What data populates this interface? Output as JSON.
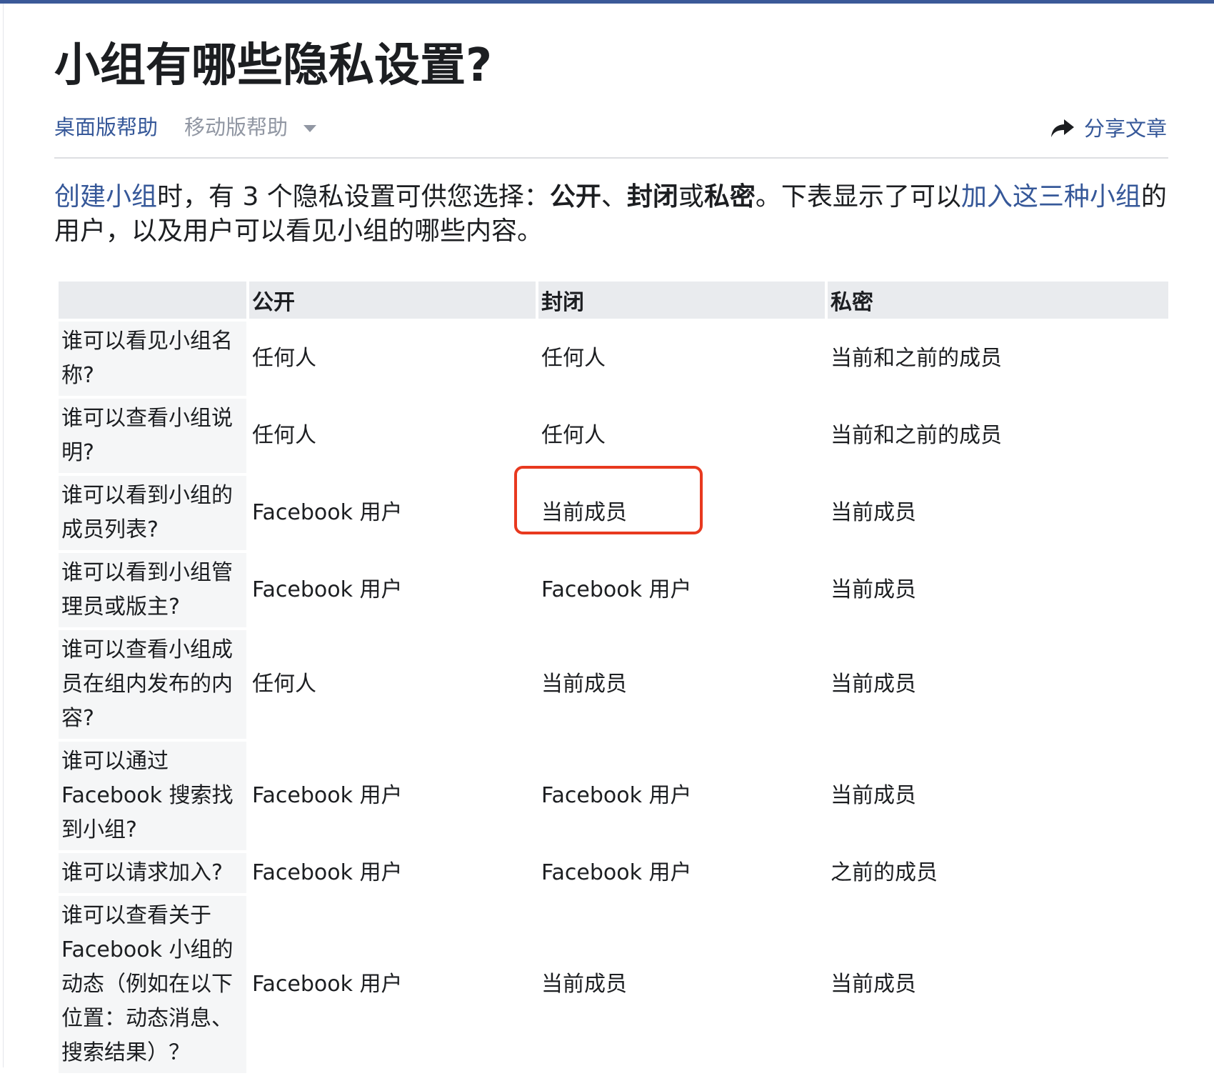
{
  "page": {
    "title": "小组有哪些隐私设置?"
  },
  "tabs": {
    "desktop": "桌面版帮助",
    "mobile": "移动版帮助"
  },
  "share": {
    "label": "分享文章",
    "icon": "share-arrow-icon"
  },
  "intro": {
    "link1": "创建小组",
    "text1": "时，有 3 个隐私设置可供您选择：",
    "opt_public": "公开",
    "sep1": "、",
    "opt_closed": "封闭",
    "sep2": "或",
    "opt_secret": "私密",
    "text2": "。下表显示了可以",
    "link2": "加入这三种小组",
    "text3": "的用户，以及用户可以看见小组的哪些内容。"
  },
  "table": {
    "headers": [
      "",
      "公开",
      "封闭",
      "私密"
    ],
    "rows": [
      [
        "谁可以看见小组名称?",
        "任何人",
        "任何人",
        "当前和之前的成员"
      ],
      [
        "谁可以查看小组说明?",
        "任何人",
        "任何人",
        "当前和之前的成员"
      ],
      [
        "谁可以看到小组的成员列表?",
        "Facebook 用户",
        "当前成员",
        "当前成员"
      ],
      [
        "谁可以看到小组管理员或版主?",
        "Facebook 用户",
        "Facebook 用户",
        "当前成员"
      ],
      [
        "谁可以查看小组成员在组内发布的内容?",
        "任何人",
        "当前成员",
        "当前成员"
      ],
      [
        "谁可以通过 Facebook 搜索找到小组?",
        "Facebook 用户",
        "Facebook 用户",
        "当前成员"
      ],
      [
        "谁可以请求加入?",
        "Facebook 用户",
        "Facebook 用户",
        "之前的成员"
      ],
      [
        "谁可以查看关于 Facebook 小组的动态（例如在以下位置：动态消息、搜索结果）？",
        "Facebook 用户",
        "当前成员",
        "当前成员"
      ]
    ]
  },
  "colors": {
    "accent": "#365899",
    "top_bar": "#3b5998",
    "highlight": "#e8391f",
    "header_bg": "#e9ebee",
    "rowhead_bg": "#f5f6f7"
  }
}
